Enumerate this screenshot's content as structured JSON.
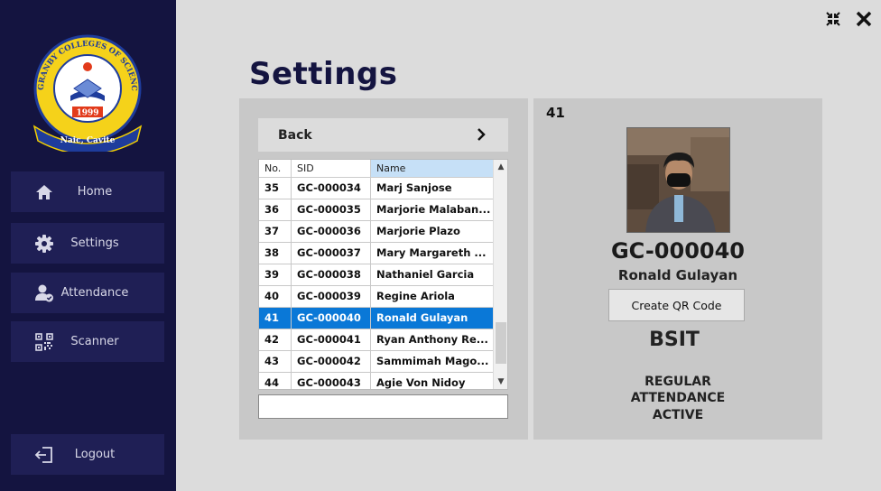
{
  "sidebar": {
    "logo": {
      "top_text": "GRANBY COLLEGES OF SCIENCE AND TECHNOLOGY",
      "year": "1999",
      "location": "Naic, Cavite"
    },
    "items": [
      {
        "label": "Home",
        "icon": "home-icon"
      },
      {
        "label": "Settings",
        "icon": "gear-icon"
      },
      {
        "label": "Attendance",
        "icon": "user-check-icon"
      },
      {
        "label": "Scanner",
        "icon": "qr-icon"
      }
    ],
    "logout": {
      "label": "Logout",
      "icon": "logout-icon"
    }
  },
  "window": {
    "minimize_icon": "collapse-icon",
    "close_icon": "close-icon"
  },
  "page": {
    "title": "Settings"
  },
  "list_panel": {
    "back_label": "Back",
    "columns": [
      "No.",
      "SID",
      "Name"
    ],
    "rows": [
      {
        "no": "35",
        "sid": "GC-000034",
        "name": "Marj Sanjose"
      },
      {
        "no": "36",
        "sid": "GC-000035",
        "name": "Marjorie Malaban..."
      },
      {
        "no": "37",
        "sid": "GC-000036",
        "name": "Marjorie Plazo"
      },
      {
        "no": "38",
        "sid": "GC-000037",
        "name": "Mary Margareth ..."
      },
      {
        "no": "39",
        "sid": "GC-000038",
        "name": "Nathaniel Garcia"
      },
      {
        "no": "40",
        "sid": "GC-000039",
        "name": "Regine Ariola"
      },
      {
        "no": "41",
        "sid": "GC-000040",
        "name": "Ronald Gulayan"
      },
      {
        "no": "42",
        "sid": "GC-000041",
        "name": "Ryan Anthony Re..."
      },
      {
        "no": "43",
        "sid": "GC-000042",
        "name": "Sammimah Mago..."
      },
      {
        "no": "44",
        "sid": "GC-000043",
        "name": "Agie Von Nidoy"
      }
    ],
    "selected_index": 6,
    "search_value": ""
  },
  "detail_panel": {
    "record_no": "41",
    "sid": "GC-000040",
    "name": "Ronald Gulayan",
    "qr_button_label": "Create QR Code",
    "course": "BSIT",
    "type": "REGULAR",
    "category": "ATTENDANCE",
    "status": "ACTIVE"
  },
  "colors": {
    "sidebar_bg": "#141440",
    "nav_item_bg": "#1f1f55",
    "title_color": "#141440",
    "selection": "#0a78d7",
    "panel_bg": "#c8c8c8",
    "page_bg": "#dcdcdc"
  }
}
